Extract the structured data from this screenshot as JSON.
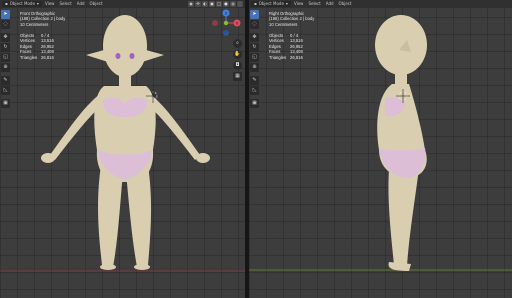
{
  "left_view": {
    "mode": "Object Mode",
    "menus": [
      "View",
      "Select",
      "Add",
      "Object"
    ],
    "view_name": "Front Orthographic",
    "collection": "(198) Collection 2 | body",
    "scale": "10 Centimeters",
    "stats": [
      {
        "label": "Objects",
        "value": "0 / 4"
      },
      {
        "label": "Vertices",
        "value": "13,516"
      },
      {
        "label": "Edges",
        "value": "26,952"
      },
      {
        "label": "Faces",
        "value": "13,408"
      },
      {
        "label": "Triangles",
        "value": "26,816"
      }
    ]
  },
  "right_view": {
    "mode": "Object Mode",
    "menus": [
      "View",
      "Select",
      "Add",
      "Object"
    ],
    "view_name": "Right Orthographic",
    "collection": "(198) Collection 2 | body",
    "scale": "10 Centimeters",
    "stats": [
      {
        "label": "Objects",
        "value": "0 / 4"
      },
      {
        "label": "Vertices",
        "value": "13,516"
      },
      {
        "label": "Edges",
        "value": "26,952"
      },
      {
        "label": "Faces",
        "value": "13,408"
      },
      {
        "label": "Triangles",
        "value": "26,816"
      }
    ]
  },
  "gizmo_axes": {
    "x": "X",
    "y": "Y",
    "z": "Z"
  },
  "colors": {
    "skin": "#d9cfb0",
    "underwear": "#dcbfd6",
    "eyes": "#a35fc7",
    "viewport_bg": "#3d3d3d",
    "header_bg": "#303030",
    "active_tool": "#4772b3",
    "axis_x": "#e04a5f",
    "axis_y": "#7ec422",
    "axis_z": "#3f80e6"
  },
  "toolbar_icons": [
    "cursor-icon",
    "select-circle-icon",
    "move-icon",
    "rotate-icon",
    "scale-icon",
    "transform-icon",
    "annotate-icon",
    "measure-icon",
    "add-cube-icon"
  ],
  "nav_icons": [
    "zoom-icon",
    "pan-hand-icon",
    "camera-icon",
    "grid-icon"
  ]
}
